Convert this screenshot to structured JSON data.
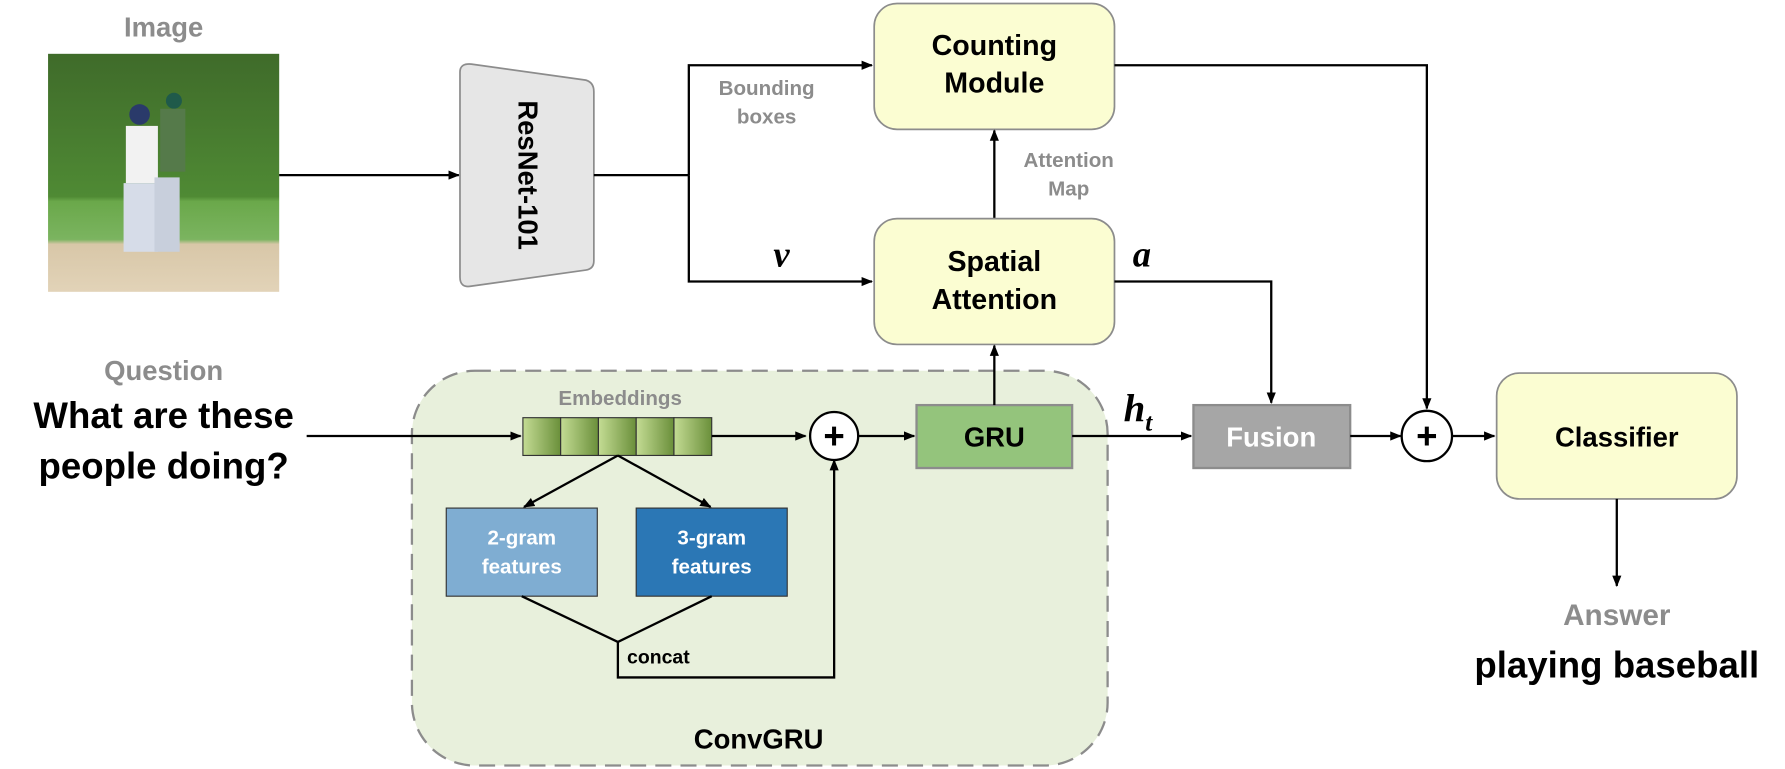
{
  "labels": {
    "image_title": "Image",
    "question_title": "Question",
    "question_line1": "What are these",
    "question_line2": "people doing?",
    "resnet": "ResNet-101",
    "bounding_line1": "Bounding",
    "bounding_line2": "boxes",
    "counting_line1": "Counting",
    "counting_line2": "Module",
    "attention_map_line1": "Attention",
    "attention_map_line2": "Map",
    "spatial_line1": "Spatial",
    "spatial_line2": "Attention",
    "v": "v",
    "a": "a",
    "h": "h",
    "h_sub": "t",
    "embeddings": "Embeddings",
    "gram2_line1": "2-gram",
    "gram2_line2": "features",
    "gram3_line1": "3-gram",
    "gram3_line2": "features",
    "concat": "concat",
    "convgru": "ConvGRU",
    "gru": "GRU",
    "fusion": "Fusion",
    "classifier": "Classifier",
    "answer_title": "Answer",
    "answer": "playing baseball",
    "plus": "+"
  },
  "colors": {
    "module_fill": "#fbfdd2",
    "convgru_fill": "#e8f0dc",
    "gru_fill": "#94c47c",
    "fusion_fill": "#a6a6a6",
    "gram2_fill": "#7fadd2",
    "gram3_fill": "#2b77b5",
    "resnet_fill": "#e6e6e6"
  }
}
